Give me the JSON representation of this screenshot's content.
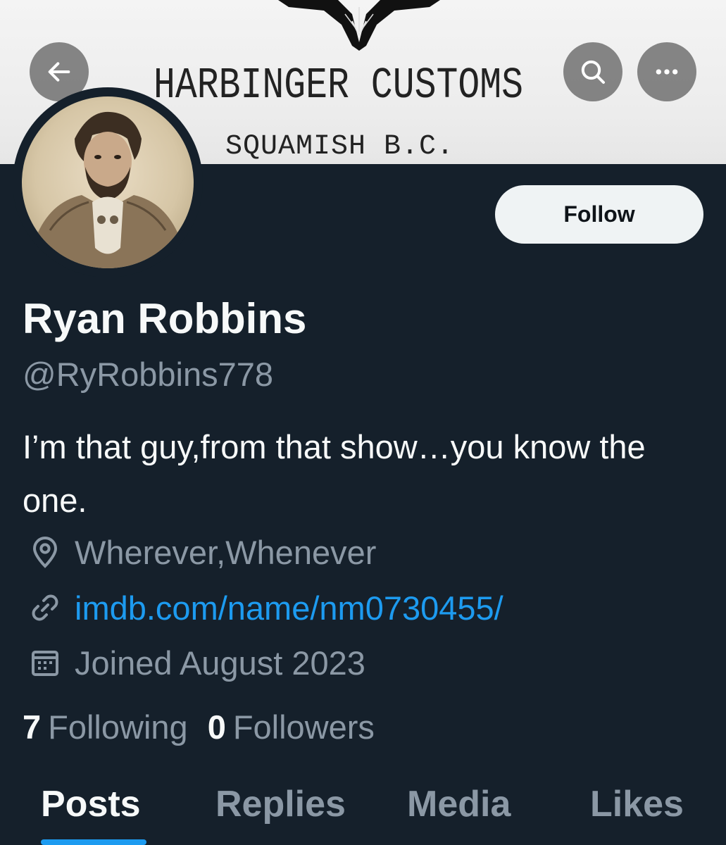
{
  "banner": {
    "title": "HARBINGER CUSTOMS",
    "subtitle": "SQUAMISH B.C."
  },
  "header": {
    "back_icon": "arrow-left-icon",
    "search_icon": "search-icon",
    "more_icon": "more-dots-icon"
  },
  "profile": {
    "follow_label": "Follow",
    "name": "Ryan Robbins",
    "handle": "@RyRobbins778",
    "bio": "I’m that guy,from that show…you know the one.",
    "location": "Wherever,Whenever",
    "website": "imdb.com/name/nm0730455/",
    "joined": "Joined August 2023"
  },
  "stats": {
    "following_count": "7",
    "following_label": "Following",
    "followers_count": "0",
    "followers_label": "Followers"
  },
  "tabs": [
    {
      "label": "Posts",
      "active": true
    },
    {
      "label": "Replies",
      "active": false
    },
    {
      "label": "Media",
      "active": false
    },
    {
      "label": "Likes",
      "active": false
    }
  ],
  "colors": {
    "background": "#15202b",
    "accent": "#1d9bf0",
    "secondary_text": "#8b98a5"
  }
}
